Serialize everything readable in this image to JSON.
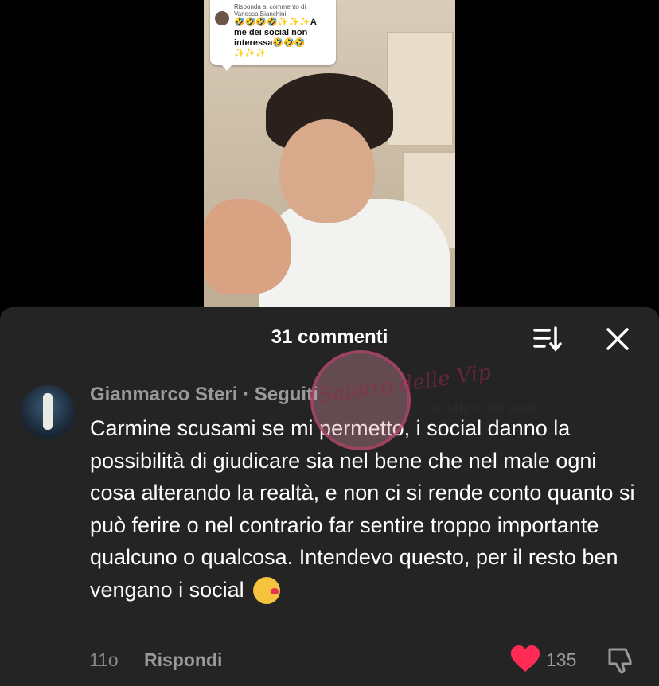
{
  "video": {
    "reply_card": {
      "meta_line1": "Risponda al commento di",
      "meta_line2": "Vanessa Bianchini",
      "text": "🤣🤣🤣🤣✨✨✨A me dei social non interessa🤣🤣🤣✨✨✨"
    }
  },
  "sheet": {
    "title": "31 commenti",
    "sort_icon": "sort-icon",
    "close_icon": "close-icon"
  },
  "comment": {
    "author": "Gianmarco Steri · Seguiti",
    "text": "Carmine scusami se mi permetto, i social danno la possibilità di giudicare sia nel bene che nel male ogni cosa alterando la realtà, e non ci si rende conto quanto si può ferire o nel contrario far sentire troppo importante qualcuno o qualcosa. Intendevo questo, per il resto ben vengano i social",
    "time": "11o",
    "reply_label": "Rispondi",
    "like_count": "135",
    "like_color": "#ff2b54"
  },
  "watermark": {
    "logo_text": "Salotto delle Vip",
    "brand_text": "le talpe del web"
  }
}
